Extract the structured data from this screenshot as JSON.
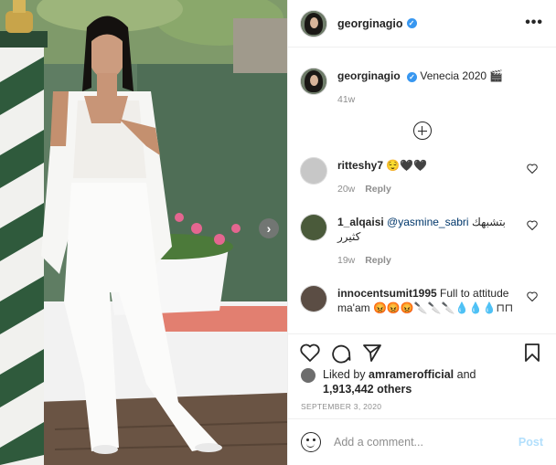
{
  "post": {
    "author": "georginagio",
    "header_more_label": "•••",
    "verified_glyph": "✓",
    "caption_text": "Venecia 2020 🎬",
    "caption_age": "41w",
    "next_arrow_glyph": "›"
  },
  "comments": [
    {
      "username": "ritteshy7",
      "text": "😌🖤🖤",
      "age": "20w",
      "reply_label": "Reply"
    },
    {
      "username": "1_alqaisi",
      "mention": "@yasmine_sabri",
      "text": "بتشبهك كثيرر",
      "age": "19w",
      "reply_label": "Reply"
    },
    {
      "username": "innocentsumit1995",
      "text": "Full to attitude ma'am 😡😡😡🔪🔪🔪💧💧💧⊓⊓",
      "age": "",
      "reply_label": ""
    }
  ],
  "likes": {
    "prefix": "Liked by",
    "first_liker": "amramerofficial",
    "and_label": "and",
    "others_count": "1,913,442 others"
  },
  "date": "SEPTEMBER 3, 2020",
  "add_comment": {
    "placeholder": "Add a comment...",
    "post_label": "Post"
  },
  "icons": {
    "more": "more-options-icon",
    "load_more": "plus-circle-icon",
    "like": "heart-icon",
    "comment": "comment-icon",
    "share": "send-icon",
    "save": "bookmark-icon",
    "emoji": "emoji-icon",
    "next": "chevron-right-icon"
  },
  "colors": {
    "verified": "#3897f0",
    "mention": "#00376b",
    "post_disabled": "#b2dffc",
    "meta": "#8e8e8e"
  }
}
